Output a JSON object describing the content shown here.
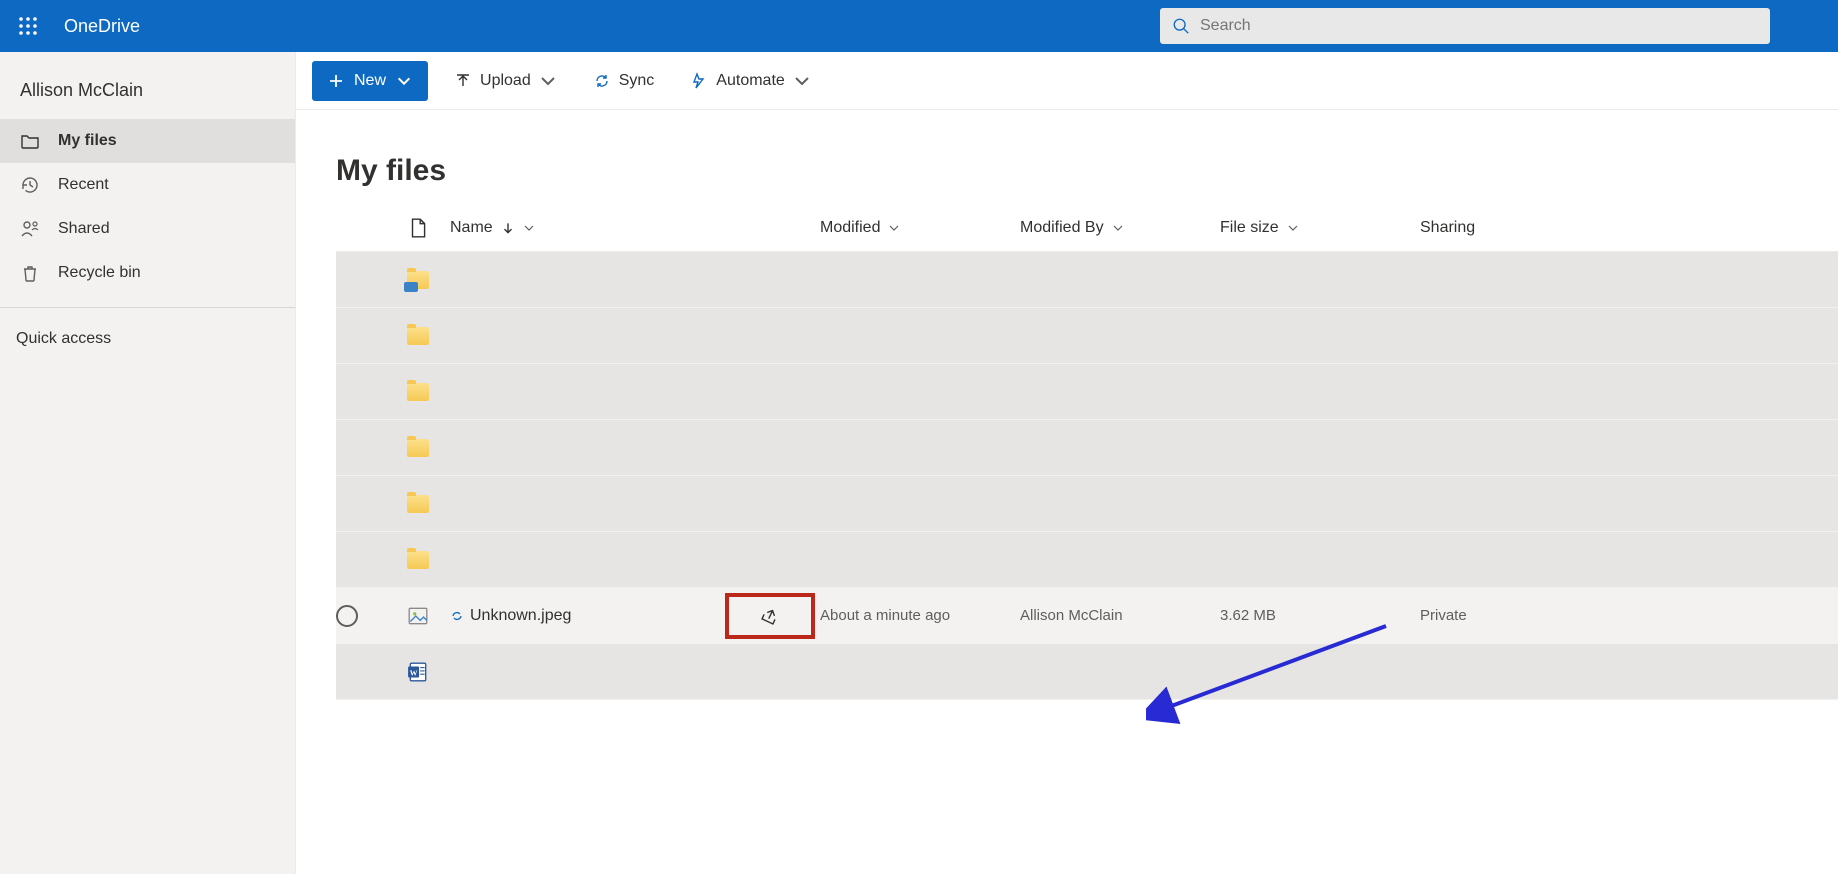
{
  "app": {
    "title": "OneDrive"
  },
  "search": {
    "placeholder": "Search"
  },
  "user": {
    "display_name": "Allison McClain"
  },
  "nav": {
    "items": [
      {
        "id": "my-files",
        "label": "My files",
        "icon": "folder-outline-icon",
        "active": true
      },
      {
        "id": "recent",
        "label": "Recent",
        "icon": "history-icon",
        "active": false
      },
      {
        "id": "shared",
        "label": "Shared",
        "icon": "person-share-icon",
        "active": false
      },
      {
        "id": "recycle",
        "label": "Recycle bin",
        "icon": "recycle-bin-icon",
        "active": false
      }
    ],
    "quick_access_label": "Quick access"
  },
  "toolbar": {
    "new_label": "New",
    "upload_label": "Upload",
    "sync_label": "Sync",
    "automate_label": "Automate"
  },
  "page": {
    "title": "My files"
  },
  "columns": {
    "name": "Name",
    "modified": "Modified",
    "modified_by": "Modified By",
    "file_size": "File size",
    "sharing": "Sharing"
  },
  "rows": [
    {
      "kind": "folder-shared",
      "redacted": true
    },
    {
      "kind": "folder",
      "redacted": true
    },
    {
      "kind": "folder",
      "redacted": true
    },
    {
      "kind": "folder",
      "redacted": true
    },
    {
      "kind": "folder",
      "redacted": true
    },
    {
      "kind": "folder",
      "redacted": true
    },
    {
      "kind": "image",
      "name": "Unknown.jpeg",
      "modified": "About a minute ago",
      "modified_by": "Allison McClain",
      "size": "3.62 MB",
      "sharing": "Private",
      "selected": true,
      "syncing": true,
      "share_highlighted": true
    },
    {
      "kind": "word",
      "redacted": true
    }
  ]
}
